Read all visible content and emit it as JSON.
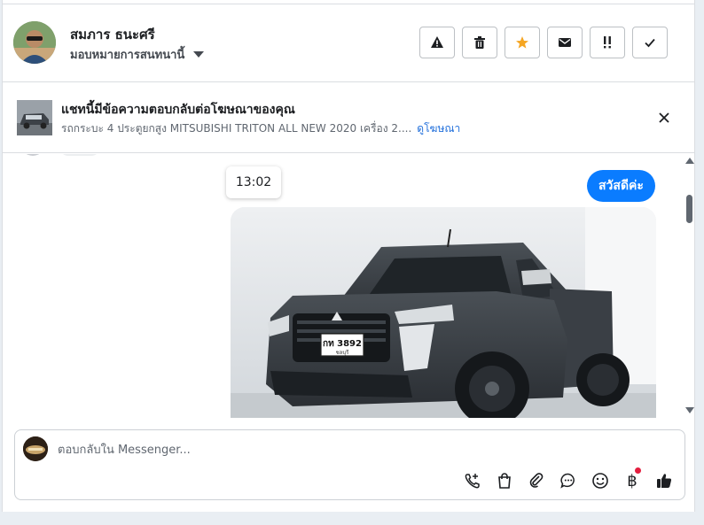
{
  "header": {
    "user_name": "สมภาร ธนะศรี",
    "assign_label": "มอบหมายการสนทนานี้",
    "actions": [
      {
        "icon": "warning-icon",
        "color": "#1c1e21"
      },
      {
        "icon": "trash-icon",
        "color": "#1c1e21"
      },
      {
        "icon": "star-icon",
        "color": "#f5a623"
      },
      {
        "icon": "mail-icon",
        "color": "#1c1e21"
      },
      {
        "icon": "follow-up-icon",
        "color": "#1c1e21"
      },
      {
        "icon": "check-icon",
        "color": "#1c1e21"
      }
    ]
  },
  "ad": {
    "title": "แชทนี้มีข้อความตอบกลับต่อโฆษณาของคุณ",
    "description": "รถกระบะ 4 ประตูยกสูง MITSUBISHI TRITON ALL NEW 2020 เครื่อง 2....",
    "link_label": "ดูโฆษณา"
  },
  "chat": {
    "timestamp": "13:02",
    "message": "สวัสดีค่ะ",
    "photo_plate": "กท 3892",
    "photo_plate_sub": "ชลบุรี",
    "bubble_color": "#0a7cff"
  },
  "composer": {
    "placeholder": "ตอบกลับใน Messenger...",
    "value": "",
    "tools": [
      "phone-add-icon",
      "shopping-bag-icon",
      "paperclip-icon",
      "chat-bubble-icon",
      "emoji-icon",
      "baht-icon",
      "thumbs-up-icon"
    ],
    "baht_symbol": "฿"
  }
}
